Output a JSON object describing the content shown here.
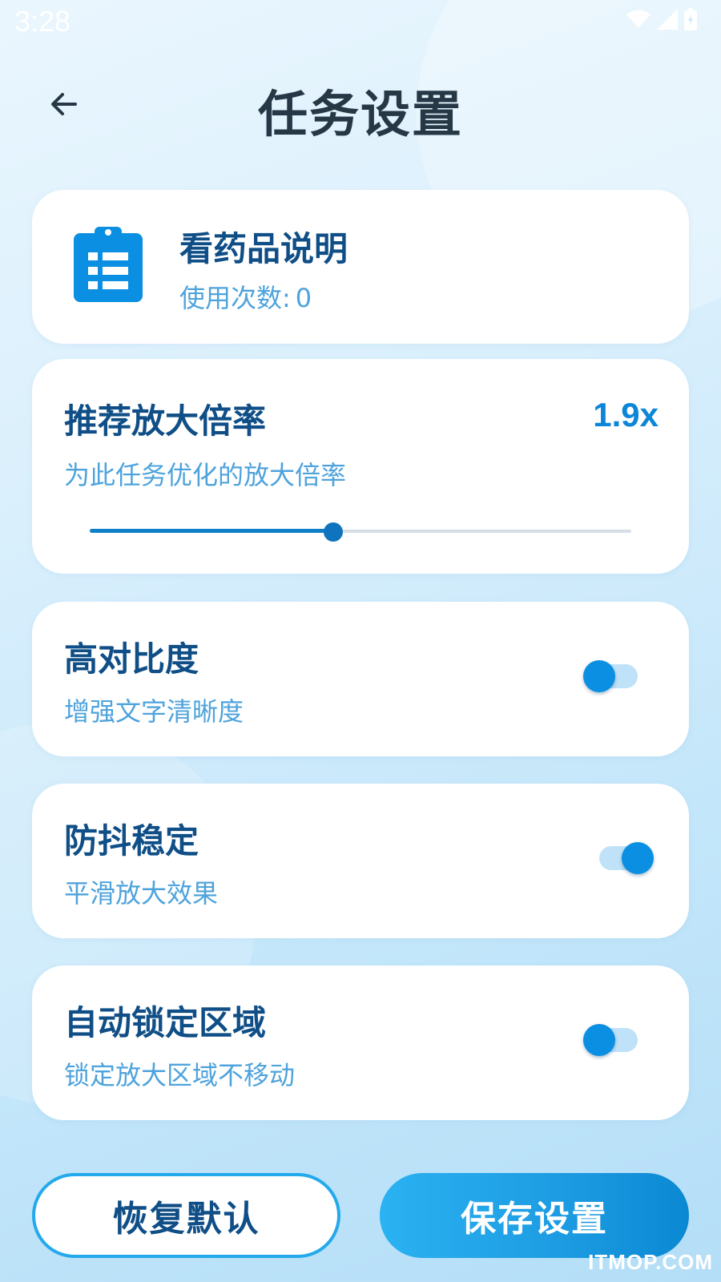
{
  "status_bar": {
    "time": "3:28",
    "icons": [
      "wifi-icon",
      "signal-icon",
      "battery-icon"
    ]
  },
  "header": {
    "back_icon": "arrow-left-icon",
    "title": "任务设置"
  },
  "task": {
    "icon": "clipboard-list-icon",
    "name": "看药品说明",
    "usage_label": "使用次数:",
    "usage_count": "0"
  },
  "zoom": {
    "title": "推荐放大倍率",
    "description": "为此任务优化的放大倍率",
    "value_label": "1.9x",
    "slider_fraction": 0.45
  },
  "options": [
    {
      "title": "高对比度",
      "description": "增强文字清晰度",
      "enabled": false
    },
    {
      "title": "防抖稳定",
      "description": "平滑放大效果",
      "enabled": true
    },
    {
      "title": "自动锁定区域",
      "description": "锁定放大区域不移动",
      "enabled": false
    }
  ],
  "buttons": {
    "reset_label": "恢复默认",
    "save_label": "保存设置"
  },
  "watermark": "ITMOP.COM",
  "colors": {
    "title_dark": "#263846",
    "primary_dark": "#0f4e86",
    "accent": "#0a8fe2",
    "subtext": "#4ea3dc"
  }
}
